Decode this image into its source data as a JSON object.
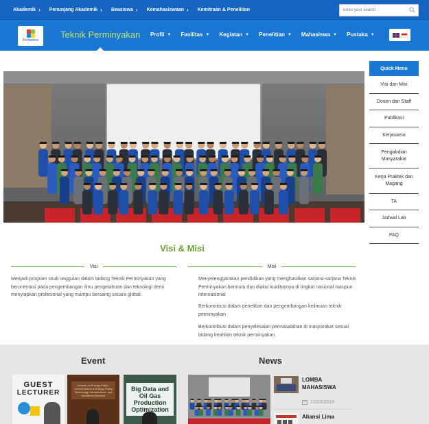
{
  "topbar": {
    "links": [
      "Akademik",
      "Penunjang Akademik",
      "Beasiswa",
      "Kemahasiswaan",
      "Kemitraan & Penelitian"
    ],
    "search_placeholder": "Enter your search",
    "bg": "#1565c0"
  },
  "header": {
    "logo_text": "Pertamina",
    "site_title": "Teknik Perminyakan",
    "menu": [
      "Profil",
      "Fasilitas",
      "Kegiatan",
      "Penelitian",
      "Mahasiswa",
      "Pustaka"
    ],
    "bg": "#1976d2",
    "title_color": "#c6e46b"
  },
  "sidebar": {
    "title": "Quick Menu",
    "items": [
      "Visi dan Misi",
      "Dosen dan Staff",
      "Publikasi",
      "Kerjasama",
      "Pengabdian Masyarakat",
      "Kerja Praktek dan Magang",
      "TA",
      "Jadwal Lab",
      "FAQ"
    ]
  },
  "visi_misi": {
    "title": "Visi & Misi",
    "visi_label": "Visi",
    "misi_label": "Misi",
    "visi_text": "Menjadi program studi unggulan dalam bidang Teknik Perminyakan yang berorientasi pada pengembangan ilmu pengetahuan dan teknologi demi menyiapkan profesional yang mampu bersaing secara global.",
    "misi": [
      "Menyelenggarakan pendidikan yang menghasilkan sarjana-sarjana Teknik Perminyakan bermutu dan diakui kualitasnya di tingkat nasional maupun internasional",
      "Berkontribusi dalam penelitian dan pengembangan keilmuan teknik perminyakan",
      "Berkontribusi dalam penyelesaian permasalahan di masyarakat sesuai bidang keahlian teknik perminyakan."
    ],
    "accent": "#6aa131"
  },
  "event": {
    "title": "Event",
    "posters": [
      {
        "line1": "GUEST",
        "line2": "LECTURER"
      },
      {
        "line1": "Outlook on Energy Policy : Current Issues in Energy Policy, Technology, Infrastructure, and Workforce Demand"
      },
      {
        "line1": "Big Data and Oil Gas Production Optimization"
      }
    ]
  },
  "news": {
    "title": "News",
    "items": [
      {
        "title": "LOMBA MAHASISWA",
        "date": "12/03/2019"
      },
      {
        "title": "Aliansi Lima"
      }
    ]
  }
}
